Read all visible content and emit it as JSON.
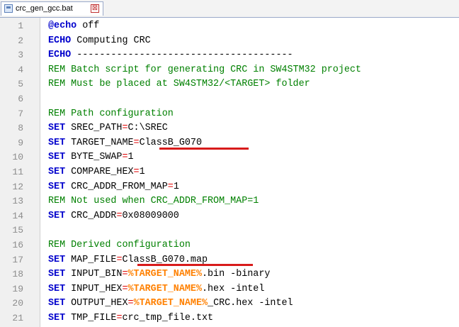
{
  "tab": {
    "label": "crc_gen_gcc.bat",
    "close_glyph": "⊠"
  },
  "lines": [
    {
      "n": "1",
      "parts": [
        {
          "c": "kw",
          "t": "@echo"
        },
        {
          "c": "plain",
          "t": " off"
        }
      ]
    },
    {
      "n": "2",
      "parts": [
        {
          "c": "kw",
          "t": "ECHO"
        },
        {
          "c": "plain",
          "t": " Computing CRC"
        }
      ]
    },
    {
      "n": "3",
      "parts": [
        {
          "c": "kw",
          "t": "ECHO"
        },
        {
          "c": "plain",
          "t": " --------------------------------------"
        }
      ]
    },
    {
      "n": "4",
      "parts": [
        {
          "c": "rem",
          "t": "REM Batch script for generating CRC in SW4STM32 project"
        }
      ]
    },
    {
      "n": "5",
      "parts": [
        {
          "c": "rem",
          "t": "REM Must be placed at SW4STM32/<TARGET> folder"
        }
      ]
    },
    {
      "n": "6",
      "parts": []
    },
    {
      "n": "7",
      "parts": [
        {
          "c": "rem",
          "t": "REM Path configuration"
        }
      ]
    },
    {
      "n": "8",
      "parts": [
        {
          "c": "kw",
          "t": "SET"
        },
        {
          "c": "plain",
          "t": " SREC_PATH"
        },
        {
          "c": "op",
          "t": "="
        },
        {
          "c": "plain",
          "t": "C:\\SREC"
        }
      ]
    },
    {
      "n": "9",
      "parts": [
        {
          "c": "kw",
          "t": "SET"
        },
        {
          "c": "plain",
          "t": " TARGET_NAME"
        },
        {
          "c": "op",
          "t": "="
        },
        {
          "c": "plain",
          "t": "ClassB_G070"
        }
      ]
    },
    {
      "n": "10",
      "parts": [
        {
          "c": "kw",
          "t": "SET"
        },
        {
          "c": "plain",
          "t": " BYTE_SWAP"
        },
        {
          "c": "op",
          "t": "="
        },
        {
          "c": "plain",
          "t": "1"
        }
      ]
    },
    {
      "n": "11",
      "parts": [
        {
          "c": "kw",
          "t": "SET"
        },
        {
          "c": "plain",
          "t": " COMPARE_HEX"
        },
        {
          "c": "op",
          "t": "="
        },
        {
          "c": "plain",
          "t": "1"
        }
      ]
    },
    {
      "n": "12",
      "parts": [
        {
          "c": "kw",
          "t": "SET"
        },
        {
          "c": "plain",
          "t": " CRC_ADDR_FROM_MAP"
        },
        {
          "c": "op",
          "t": "="
        },
        {
          "c": "plain",
          "t": "1"
        }
      ]
    },
    {
      "n": "13",
      "parts": [
        {
          "c": "rem",
          "t": "REM Not used when CRC_ADDR_FROM_MAP=1"
        }
      ]
    },
    {
      "n": "14",
      "parts": [
        {
          "c": "kw",
          "t": "SET"
        },
        {
          "c": "plain",
          "t": " CRC_ADDR"
        },
        {
          "c": "op",
          "t": "="
        },
        {
          "c": "plain",
          "t": "0x08009000"
        }
      ]
    },
    {
      "n": "15",
      "parts": []
    },
    {
      "n": "16",
      "parts": [
        {
          "c": "rem",
          "t": "REM Derived configuration"
        }
      ]
    },
    {
      "n": "17",
      "parts": [
        {
          "c": "kw",
          "t": "SET"
        },
        {
          "c": "plain",
          "t": " MAP_FILE"
        },
        {
          "c": "op",
          "t": "="
        },
        {
          "c": "plain",
          "t": "ClassB_G070.map"
        }
      ]
    },
    {
      "n": "18",
      "parts": [
        {
          "c": "kw",
          "t": "SET"
        },
        {
          "c": "plain",
          "t": " INPUT_BIN"
        },
        {
          "c": "op",
          "t": "="
        },
        {
          "c": "var",
          "t": "%TARGET_NAME%"
        },
        {
          "c": "plain",
          "t": ".bin -binary"
        }
      ]
    },
    {
      "n": "19",
      "parts": [
        {
          "c": "kw",
          "t": "SET"
        },
        {
          "c": "plain",
          "t": " INPUT_HEX"
        },
        {
          "c": "op",
          "t": "="
        },
        {
          "c": "var",
          "t": "%TARGET_NAME%"
        },
        {
          "c": "plain",
          "t": ".hex -intel"
        }
      ]
    },
    {
      "n": "20",
      "parts": [
        {
          "c": "kw",
          "t": "SET"
        },
        {
          "c": "plain",
          "t": " OUTPUT_HEX"
        },
        {
          "c": "op",
          "t": "="
        },
        {
          "c": "var",
          "t": "%TARGET_NAME%"
        },
        {
          "c": "plain",
          "t": "_CRC.hex -intel"
        }
      ]
    },
    {
      "n": "21",
      "parts": [
        {
          "c": "kw",
          "t": "SET"
        },
        {
          "c": "plain",
          "t": " TMP_FILE"
        },
        {
          "c": "op",
          "t": "="
        },
        {
          "c": "plain",
          "t": "crc_tmp_file.txt"
        }
      ]
    }
  ],
  "colors": {
    "keyword": "#0000cc",
    "comment": "#008000",
    "operator": "#e00000",
    "variable": "#ff8000",
    "annotation_underline": "#d81b1b"
  }
}
